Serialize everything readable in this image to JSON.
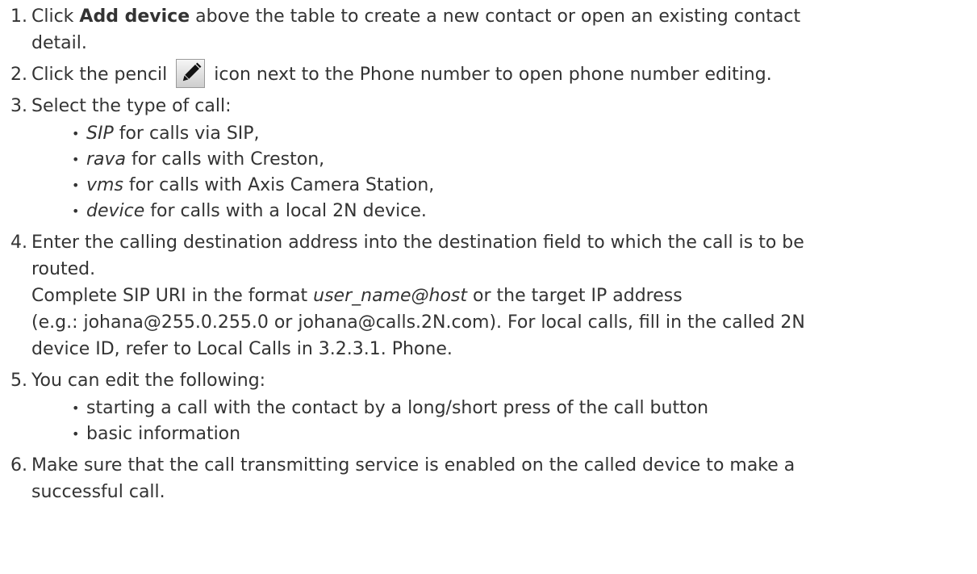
{
  "steps": [
    {
      "num": "1.",
      "pre": "Click ",
      "bold": "Add device",
      "post_line1": " above the table to create a new contact or open an existing contact",
      "line2": "detail."
    },
    {
      "num": "2.",
      "pre": "Click the pencil ",
      "icon": "pencil-icon",
      "post": " icon next to the Phone number to open phone number editing."
    },
    {
      "num": "3.",
      "text": "Select the type of call:",
      "bullets": [
        {
          "term": "SIP",
          "rest": " for calls via SIP,"
        },
        {
          "term": "rava",
          "rest": " for calls with Creston,"
        },
        {
          "term": "vms",
          "rest": " for calls with Axis Camera Station,"
        },
        {
          "term": "device",
          "rest": " for calls with a local 2N device."
        }
      ]
    },
    {
      "num": "4.",
      "line1": "Enter the calling destination address into the destination field to which the call is to be",
      "line2": "routed.",
      "line3_pre": "Complete SIP URI in the format ",
      "line3_em": "user_name@host",
      "line3_post": " or the target IP address",
      "line4": "(e.g.: johana@255.0.255.0 or johana@calls.2N.com). For local calls, fill in the called 2N",
      "line5": "device ID, refer to Local Calls in 3.2.3.1. Phone."
    },
    {
      "num": "5.",
      "text": "You can edit the following:",
      "bullets": [
        {
          "text": "starting a call with the contact by a long/short press of the call button"
        },
        {
          "text": "basic information"
        }
      ]
    },
    {
      "num": "6.",
      "line1": "Make sure that the call transmitting service is enabled on the called device to make a",
      "line2": "successful call."
    }
  ],
  "colors": {
    "text": "#333333",
    "icon_bg_top": "#f4f4f4",
    "icon_bg_bottom": "#cfcfcf",
    "icon_border": "#9a9a9a",
    "icon_glyph": "#111111"
  }
}
